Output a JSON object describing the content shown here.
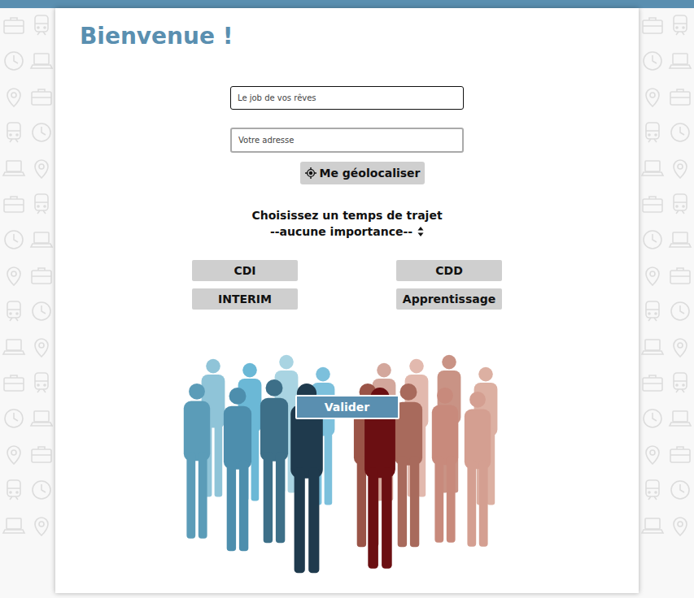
{
  "header": {
    "title": "Bienvenue !"
  },
  "fields": [
    {
      "placeholder": "Le job de vos rêves",
      "focused": true
    },
    {
      "placeholder": "Votre adresse",
      "focused": false
    }
  ],
  "geolocate": {
    "label": "Me géolocaliser"
  },
  "travel_time": {
    "label": "Choisissez un temps de trajet",
    "value": "--aucune importance--"
  },
  "contract_types": [
    {
      "label": "CDI",
      "selected": false
    },
    {
      "label": "CDD",
      "selected": false
    },
    {
      "label": "INTERIM",
      "selected": false
    },
    {
      "label": "Apprentissage",
      "selected": false
    }
  ],
  "submit": {
    "label": "Valider"
  }
}
